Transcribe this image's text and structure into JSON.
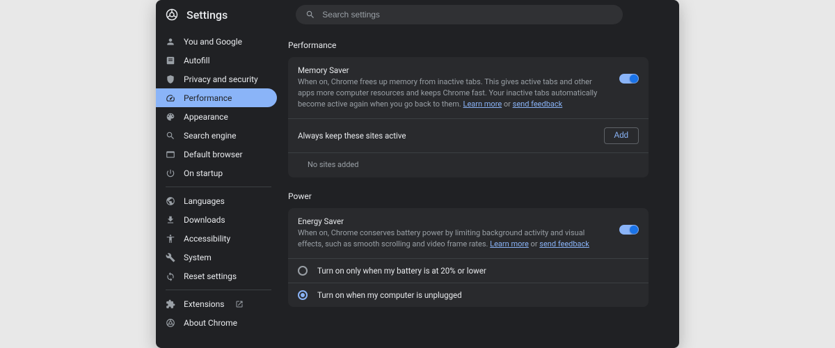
{
  "header": {
    "title": "Settings",
    "search_placeholder": "Search settings"
  },
  "sidebar": {
    "groups": [
      [
        {
          "icon": "person",
          "label": "You and Google"
        },
        {
          "icon": "autofill",
          "label": "Autofill"
        },
        {
          "icon": "shield",
          "label": "Privacy and security"
        },
        {
          "icon": "performance",
          "label": "Performance",
          "active": true
        },
        {
          "icon": "appearance",
          "label": "Appearance"
        },
        {
          "icon": "search",
          "label": "Search engine"
        },
        {
          "icon": "default-browser",
          "label": "Default browser"
        },
        {
          "icon": "startup",
          "label": "On startup"
        }
      ],
      [
        {
          "icon": "globe",
          "label": "Languages"
        },
        {
          "icon": "download",
          "label": "Downloads"
        },
        {
          "icon": "accessibility",
          "label": "Accessibility"
        },
        {
          "icon": "system",
          "label": "System"
        },
        {
          "icon": "reset",
          "label": "Reset settings"
        }
      ],
      [
        {
          "icon": "extensions",
          "label": "Extensions",
          "external": true
        },
        {
          "icon": "chrome",
          "label": "About Chrome"
        }
      ]
    ]
  },
  "content": {
    "performance": {
      "section_title": "Performance",
      "memory_saver": {
        "title": "Memory Saver",
        "desc_before": "When on, Chrome frees up memory from inactive tabs. This gives active tabs and other apps more computer resources and keeps Chrome fast. Your inactive tabs automatically become active again when you go back to them. ",
        "learn_more": "Learn more",
        "or": " or ",
        "send_feedback": "send feedback",
        "toggle": true
      },
      "always_active": {
        "title": "Always keep these sites active",
        "add_button": "Add",
        "no_sites": "No sites added"
      }
    },
    "power": {
      "section_title": "Power",
      "energy_saver": {
        "title": "Energy Saver",
        "desc_before": "When on, Chrome conserves battery power by limiting background activity and visual effects, such as smooth scrolling and video frame rates. ",
        "learn_more": "Learn more",
        "or": " or ",
        "send_feedback": "send feedback",
        "toggle": true
      },
      "radio_options": [
        {
          "label": "Turn on only when my battery is at 20% or lower",
          "checked": false
        },
        {
          "label": "Turn on when my computer is unplugged",
          "checked": true
        }
      ]
    }
  }
}
